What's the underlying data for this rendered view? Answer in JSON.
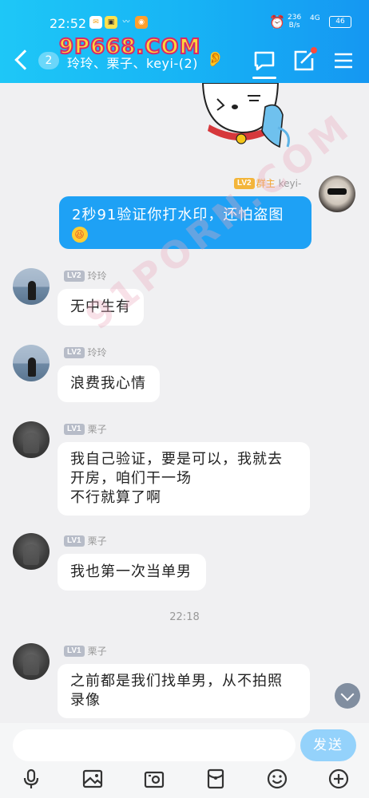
{
  "status_bar": {
    "time": "22:52",
    "net_speed_value": "236",
    "net_speed_unit": "B/s",
    "signal": "4G",
    "battery": "46"
  },
  "header": {
    "unread_count": "2",
    "title": "玲玲、栗子、keyi-(2)"
  },
  "messages": [
    {
      "level": "LV2",
      "role": "群主",
      "name": "keyi-",
      "text": "2秒91验证你打水印，还怕盗图"
    },
    {
      "level": "LV2",
      "name": "玲玲",
      "text": "无中生有"
    },
    {
      "level": "LV2",
      "name": "玲玲",
      "text": "浪费我心情"
    },
    {
      "level": "LV1",
      "name": "栗子",
      "text_lines": [
        "我自己验证，要是可以，我就去",
        "开房，咱们干一场",
        "不行就算了啊"
      ]
    },
    {
      "level": "LV1",
      "name": "栗子",
      "text": "我也第一次当单男"
    },
    {
      "level": "LV1",
      "name": "栗子",
      "text_lines": [
        "之前都是我们找单男，从不拍照",
        "录像"
      ]
    }
  ],
  "timestamp": "22:18",
  "input": {
    "placeholder": "",
    "send_label": "发送"
  },
  "watermark": {
    "logo": "9P668.COM",
    "diagonal": "91PORN.COM"
  },
  "colors": {
    "header_start": "#1ec7f7",
    "header_end": "#1597f2",
    "my_bubble": "#1ea1f5",
    "send_button": "#94d2fb"
  }
}
